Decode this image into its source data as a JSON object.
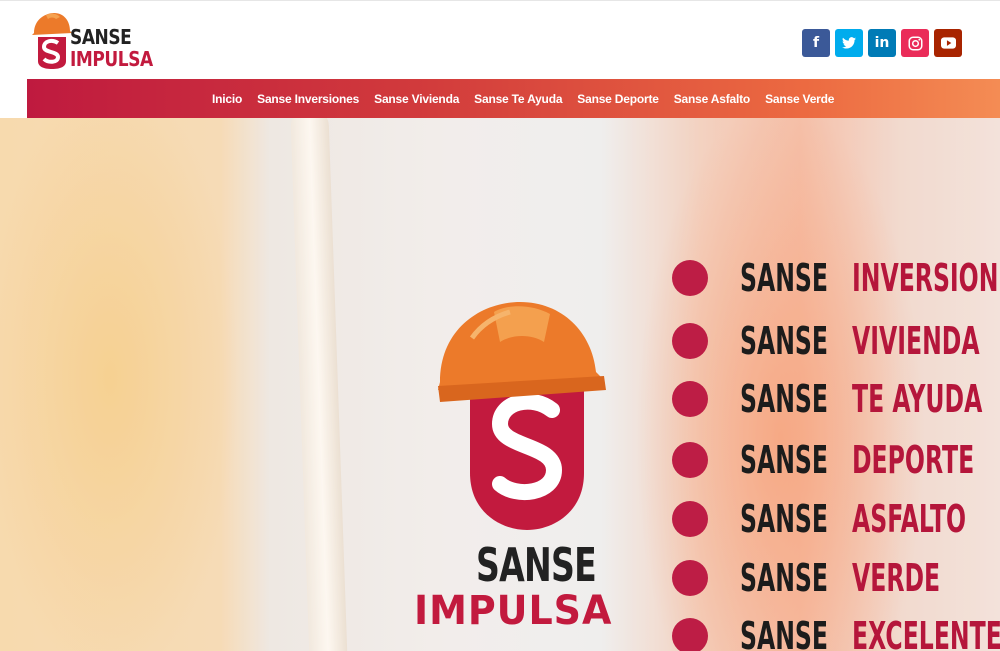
{
  "brand": {
    "line1": "SANSE",
    "line2": "IMPULSA"
  },
  "social": [
    {
      "name": "facebook",
      "glyph": "f",
      "color": "#3b5998"
    },
    {
      "name": "twitter",
      "glyph": "t",
      "color": "#00aced"
    },
    {
      "name": "linkedin",
      "glyph": "in",
      "color": "#007bb6"
    },
    {
      "name": "instagram",
      "glyph": "◎",
      "color": "#ea2c59"
    },
    {
      "name": "youtube",
      "glyph": "▶",
      "color": "#a82400"
    }
  ],
  "nav": {
    "items": [
      "Inicio",
      "Sanse Inversiones",
      "Sanse Vivienda",
      "Sanse Te Ayuda",
      "Sanse Deporte",
      "Sanse Asfalto",
      "Sanse Verde"
    ]
  },
  "hero": {
    "logo_line1": "SANSE",
    "logo_line2": "IMPULSA",
    "list": [
      {
        "a": "SANSE",
        "b": "INVERSIONES"
      },
      {
        "a": "SANSE",
        "b": "VIVIENDA"
      },
      {
        "a": "SANSE",
        "b": "TE AYUDA"
      },
      {
        "a": "SANSE",
        "b": "DEPORTE"
      },
      {
        "a": "SANSE",
        "b": "ASFALTO"
      },
      {
        "a": "SANSE",
        "b": "VERDE"
      },
      {
        "a": "SANSE",
        "b": "EXCELENTE"
      }
    ]
  },
  "colors": {
    "brand_red": "#c21a3e",
    "nav_start": "#bf1a3f",
    "nav_end": "#f48c54"
  }
}
